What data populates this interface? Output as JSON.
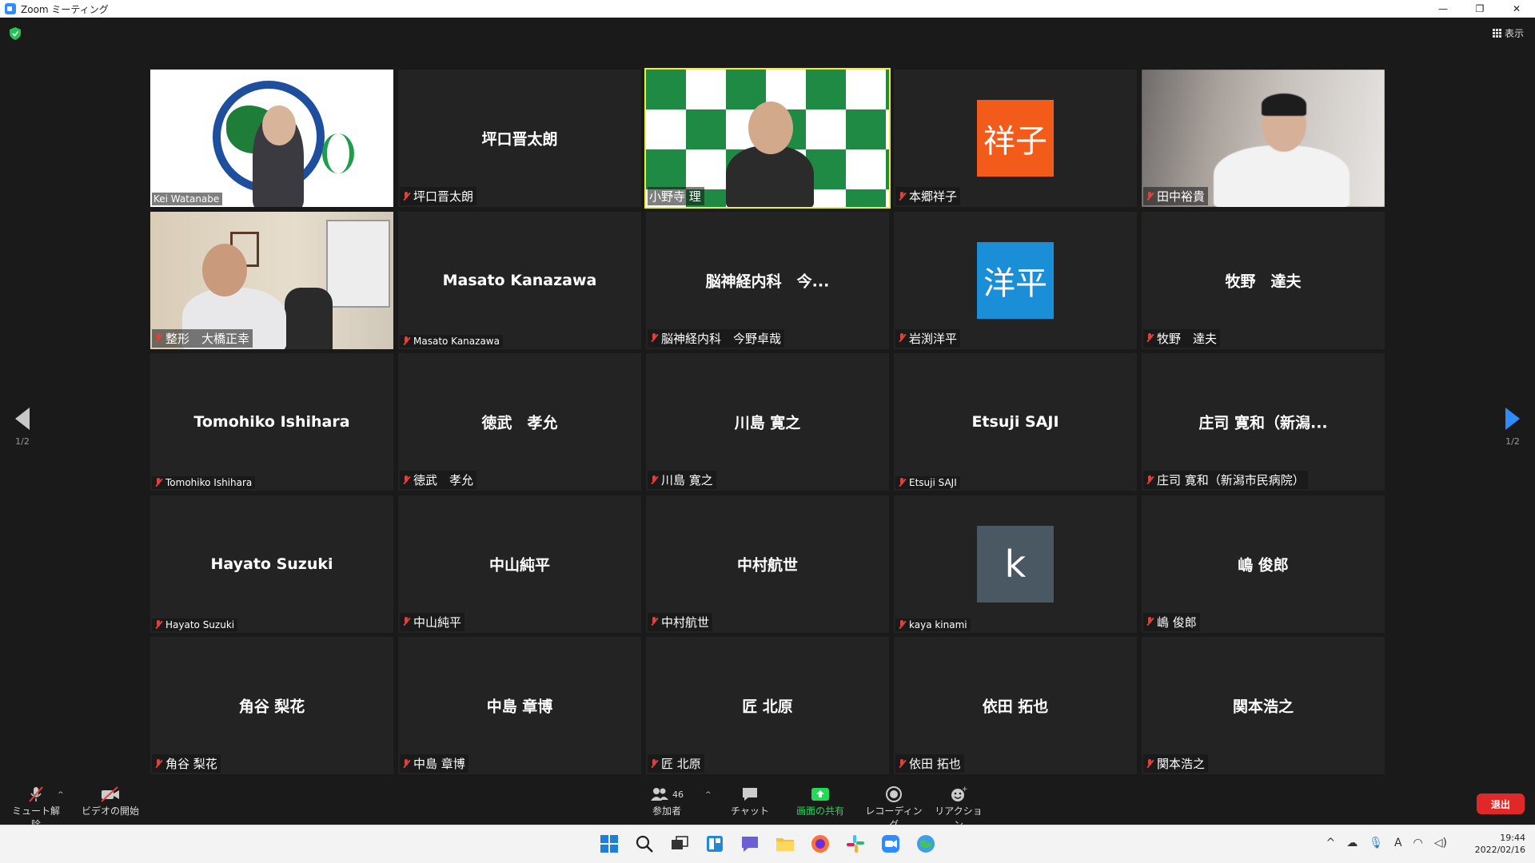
{
  "window": {
    "title": "Zoom ミーティング",
    "controls": [
      "—",
      "❐",
      "✕"
    ]
  },
  "view_button": {
    "label": "表示"
  },
  "pagination": {
    "left": "1/2",
    "right": "1/2"
  },
  "tiles": [
    {
      "center": "",
      "label": "Kei Watanabe",
      "video": "logo",
      "small": true
    },
    {
      "center": "坪口晋太朗",
      "label": "坪口晋太朗"
    },
    {
      "center": "",
      "label": "小野寺 理",
      "video": "pattern",
      "active": true
    },
    {
      "center": "",
      "label": "本郷祥子",
      "avatar": "祥子",
      "avatar_color": "#f25b1a"
    },
    {
      "center": "",
      "label": "田中裕貴",
      "video": "lab"
    },
    {
      "center": "",
      "label": "整形　大橋正幸",
      "video": "office"
    },
    {
      "center": "Masato Kanazawa",
      "label": "Masato Kanazawa",
      "small": true
    },
    {
      "center": "脳神経内科　今...",
      "label": "脳神経内科　今野卓哉"
    },
    {
      "center": "",
      "label": "岩渕洋平",
      "avatar": "洋平",
      "avatar_color": "#1a8fd8"
    },
    {
      "center": "牧野　達夫",
      "label": "牧野　達夫"
    },
    {
      "center": "Tomohiko Ishihara",
      "label": "Tomohiko Ishihara",
      "small": true
    },
    {
      "center": "徳武　孝允",
      "label": "徳武　孝允"
    },
    {
      "center": "川島 寛之",
      "label": "川島 寛之"
    },
    {
      "center": "Etsuji SAJI",
      "label": "Etsuji SAJI",
      "small": true
    },
    {
      "center": "庄司 寛和（新潟...",
      "label": "庄司 寛和（新潟市民病院）"
    },
    {
      "center": "Hayato Suzuki",
      "label": "Hayato Suzuki",
      "small": true
    },
    {
      "center": "中山純平",
      "label": "中山純平"
    },
    {
      "center": "中村航世",
      "label": "中村航世"
    },
    {
      "center": "",
      "label": "kaya kinami",
      "avatar": "k",
      "avatar_color": "#4a5863",
      "small": true
    },
    {
      "center": "嶋 俊郎",
      "label": "嶋 俊郎"
    },
    {
      "center": "角谷 梨花",
      "label": "角谷 梨花"
    },
    {
      "center": "中島 章博",
      "label": "中島 章博"
    },
    {
      "center": "匠 北原",
      "label": "匠 北原"
    },
    {
      "center": "依田 拓也",
      "label": "依田 拓也"
    },
    {
      "center": "関本浩之",
      "label": "関本浩之"
    }
  ],
  "toolbar": {
    "unmute": "ミュート解除",
    "start_video": "ビデオの開始",
    "participants": "参加者",
    "participants_count": "46",
    "chat": "チャット",
    "share": "画面の共有",
    "record": "レコーディング",
    "reactions": "リアクション",
    "leave": "退出"
  },
  "taskbar": {
    "time": "19:44",
    "date": "2022/02/16",
    "ime": "A"
  }
}
